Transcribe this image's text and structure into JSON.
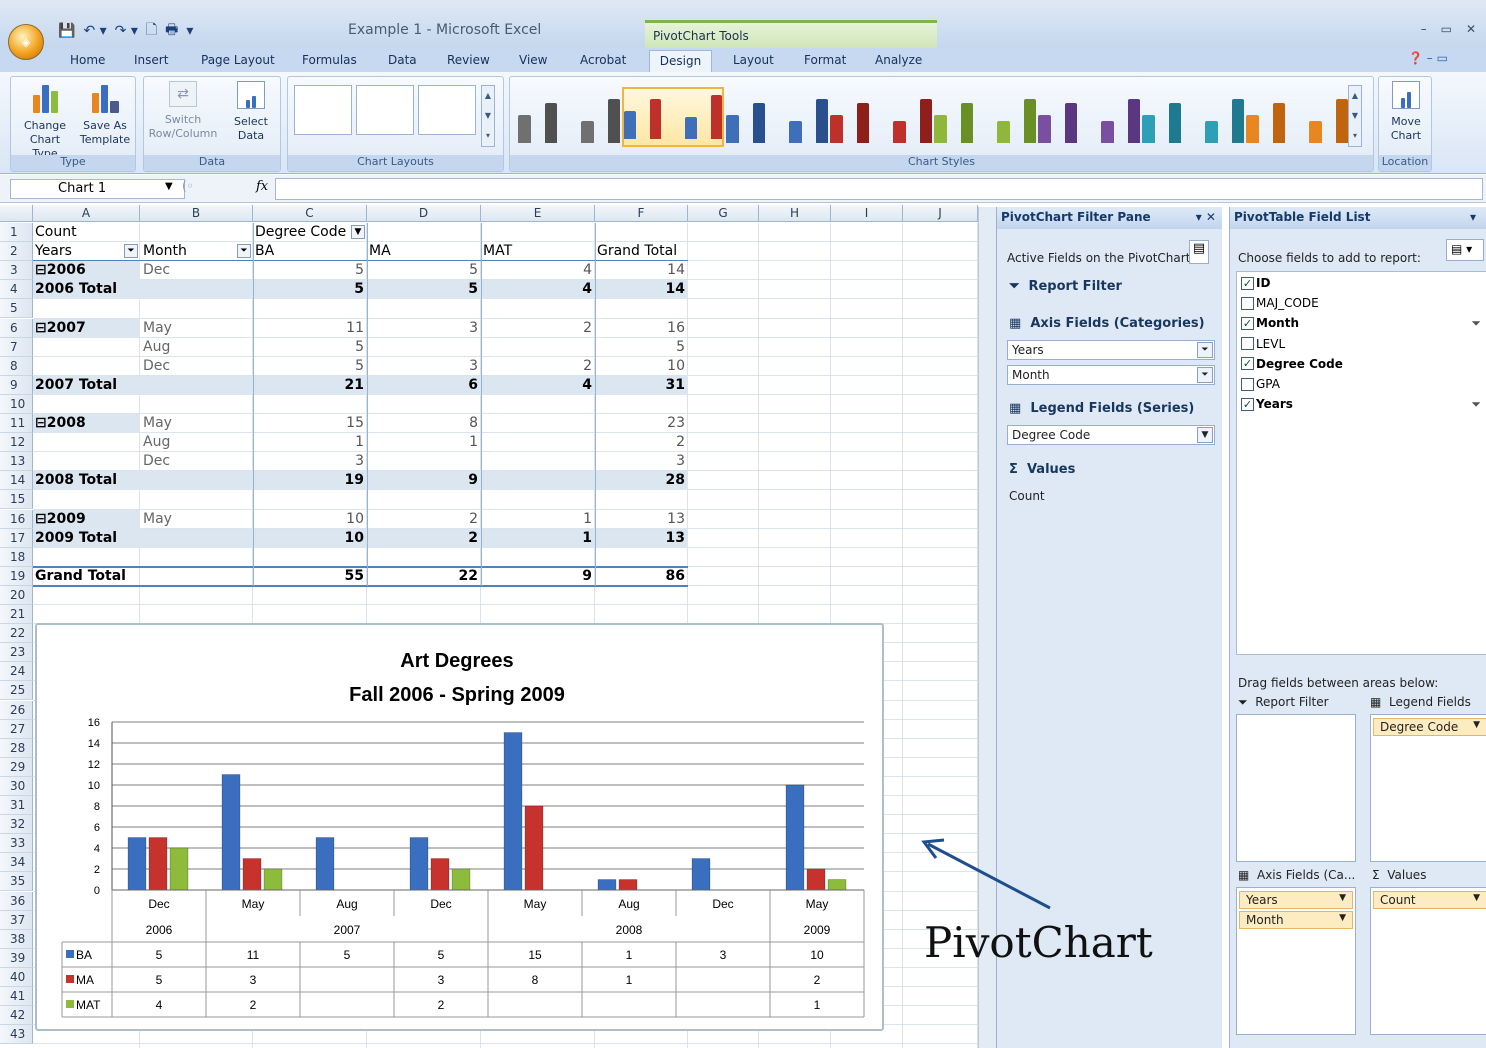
{
  "window": {
    "title": "Example 1 - Microsoft Excel",
    "context_tools": "PivotChart Tools",
    "office_button": "Office"
  },
  "tabs": [
    "Home",
    "Insert",
    "Page Layout",
    "Formulas",
    "Data",
    "Review",
    "View",
    "Acrobat",
    "Design",
    "Layout",
    "Format",
    "Analyze"
  ],
  "ribbon": {
    "type_group": {
      "label": "Type",
      "change_chart_type": [
        "Change",
        "Chart Type"
      ],
      "save_as_template": [
        "Save As",
        "Template"
      ]
    },
    "data_group": {
      "label": "Data",
      "switch_row_column": [
        "Switch",
        "Row/Column"
      ],
      "select_data": [
        "Select",
        "Data"
      ]
    },
    "chart_layouts_label": "Chart Layouts",
    "chart_styles_label": "Chart Styles",
    "location_group": {
      "label": "Location",
      "move_chart": [
        "Move",
        "Chart"
      ]
    },
    "style_colors": [
      [
        "#707070",
        "#505050"
      ],
      [
        "#3f6fb8",
        "#c0302a"
      ],
      [
        "#3f6fb8",
        "#2a4f8e"
      ],
      [
        "#c0302a",
        "#8e1f1a"
      ],
      [
        "#8fb83a",
        "#6a8f25"
      ],
      [
        "#7a4fa0",
        "#5b3781"
      ],
      [
        "#2f9fb8",
        "#1f7a90"
      ],
      [
        "#e8861f",
        "#c0650d"
      ]
    ],
    "selected_style": 1
  },
  "formula_bar": {
    "name_box": "Chart 1",
    "fx": "fx",
    "value": ""
  },
  "sheet": {
    "columns": [
      "A",
      "B",
      "C",
      "D",
      "E",
      "F",
      "G",
      "H",
      "I",
      "J"
    ],
    "rows": [
      "1",
      "2",
      "3",
      "4",
      "5",
      "6",
      "7",
      "8",
      "9",
      "10",
      "11",
      "12",
      "13",
      "14",
      "15",
      "16",
      "17",
      "18",
      "19",
      "20",
      "21",
      "22",
      "23",
      "24",
      "25",
      "26",
      "27",
      "28",
      "29",
      "30",
      "31",
      "32",
      "33",
      "34",
      "35",
      "36",
      "37",
      "38",
      "39",
      "40",
      "41",
      "42",
      "43"
    ],
    "pivot": {
      "count_label": "Count",
      "degree_code_label": "Degree Code",
      "years_label": "Years",
      "month_label": "Month",
      "headers": [
        "BA",
        "MA",
        "MAT",
        "Grand Total"
      ],
      "lines": [
        {
          "row": 3,
          "a": "⊟2006",
          "b": "Dec",
          "v": [
            "5",
            "5",
            "4",
            "14"
          ],
          "type": "item"
        },
        {
          "row": 4,
          "a": "2006 Total",
          "b": "",
          "v": [
            "5",
            "5",
            "4",
            "14"
          ],
          "type": "total"
        },
        {
          "row": 6,
          "a": "⊟2007",
          "b": "May",
          "v": [
            "11",
            "3",
            "2",
            "16"
          ],
          "type": "item"
        },
        {
          "row": 7,
          "a": "",
          "b": "Aug",
          "v": [
            "5",
            "",
            "",
            "5"
          ],
          "type": "item"
        },
        {
          "row": 8,
          "a": "",
          "b": "Dec",
          "v": [
            "5",
            "3",
            "2",
            "10"
          ],
          "type": "item"
        },
        {
          "row": 9,
          "a": "2007 Total",
          "b": "",
          "v": [
            "21",
            "6",
            "4",
            "31"
          ],
          "type": "total"
        },
        {
          "row": 11,
          "a": "⊟2008",
          "b": "May",
          "v": [
            "15",
            "8",
            "",
            "23"
          ],
          "type": "item"
        },
        {
          "row": 12,
          "a": "",
          "b": "Aug",
          "v": [
            "1",
            "1",
            "",
            "2"
          ],
          "type": "item"
        },
        {
          "row": 13,
          "a": "",
          "b": "Dec",
          "v": [
            "3",
            "",
            "",
            "3"
          ],
          "type": "item"
        },
        {
          "row": 14,
          "a": "2008 Total",
          "b": "",
          "v": [
            "19",
            "9",
            "",
            "28"
          ],
          "type": "total"
        },
        {
          "row": 16,
          "a": "⊟2009",
          "b": "May",
          "v": [
            "10",
            "2",
            "1",
            "13"
          ],
          "type": "item"
        },
        {
          "row": 17,
          "a": "2009 Total",
          "b": "",
          "v": [
            "10",
            "2",
            "1",
            "13"
          ],
          "type": "total"
        },
        {
          "row": 19,
          "a": "Grand Total",
          "b": "",
          "v": [
            "55",
            "22",
            "9",
            "86"
          ],
          "type": "grand"
        }
      ]
    }
  },
  "chart_data": {
    "type": "bar",
    "title": "Art Degrees",
    "subtitle": "Fall 2006 - Spring 2009",
    "categories": [
      "Dec",
      "May",
      "Aug",
      "Dec",
      "May",
      "Aug",
      "Dec",
      "May"
    ],
    "groups": [
      {
        "label": "2006",
        "span": 1
      },
      {
        "label": "2007",
        "span": 3
      },
      {
        "label": "2008",
        "span": 3
      },
      {
        "label": "2009",
        "span": 1
      }
    ],
    "series": [
      {
        "name": "BA",
        "color": "#3a6fc0",
        "values": [
          5,
          11,
          5,
          5,
          15,
          1,
          3,
          10
        ]
      },
      {
        "name": "MA",
        "color": "#c8322c",
        "values": [
          5,
          3,
          null,
          3,
          8,
          1,
          null,
          2
        ]
      },
      {
        "name": "MAT",
        "color": "#8dbb3c",
        "values": [
          4,
          2,
          null,
          2,
          null,
          null,
          null,
          1
        ]
      }
    ],
    "ylim": [
      0,
      16
    ],
    "yticks": [
      0,
      2,
      4,
      6,
      8,
      10,
      12,
      14,
      16
    ],
    "grid": true,
    "legend": "data table"
  },
  "filter_pane": {
    "title": "PivotChart Filter Pane",
    "active_fields": "Active Fields on the PivotChart",
    "report_filter": "Report Filter",
    "axis_fields": "Axis Fields (Categories)",
    "axis_items": [
      "Years",
      "Month"
    ],
    "legend_fields": "Legend Fields (Series)",
    "legend_item": "Degree Code",
    "values_label": "Values",
    "values_item": "Count"
  },
  "field_list": {
    "title": "PivotTable Field List",
    "choose_label": "Choose fields to add to report:",
    "fields": [
      {
        "name": "ID",
        "checked": true,
        "filter": false
      },
      {
        "name": "MAJ_CODE",
        "checked": false,
        "filter": false
      },
      {
        "name": "Month",
        "checked": true,
        "filter": true
      },
      {
        "name": "LEVL",
        "checked": false,
        "filter": false
      },
      {
        "name": "Degree Code",
        "checked": true,
        "filter": false
      },
      {
        "name": "GPA",
        "checked": false,
        "filter": false
      },
      {
        "name": "Years",
        "checked": true,
        "filter": true
      }
    ],
    "drag_label": "Drag fields between areas below:",
    "report_filter": "Report Filter",
    "legend_fields": "Legend Fields ...",
    "legend_item": "Degree Code",
    "axis_fields": "Axis Fields (Ca...",
    "axis_items": [
      "Years",
      "Month"
    ],
    "values": "Values",
    "values_item": "Count"
  },
  "annotation": {
    "label": "PivotChart"
  }
}
